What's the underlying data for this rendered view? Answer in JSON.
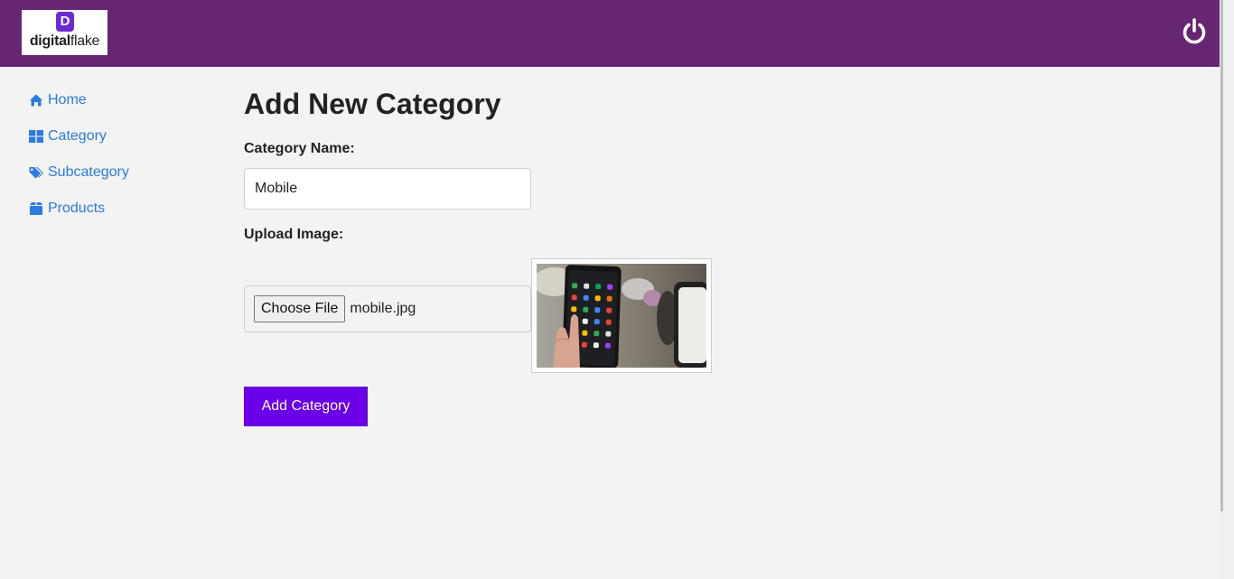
{
  "header": {
    "logo_letter": "D",
    "logo_text_bold": "digital",
    "logo_text_rest": "flake",
    "power_icon": "power-icon",
    "background": "#662672"
  },
  "sidebar": {
    "items": [
      {
        "label": "Home",
        "icon": "home-icon"
      },
      {
        "label": "Category",
        "icon": "grid-icon"
      },
      {
        "label": "Subcategory",
        "icon": "tags-icon"
      },
      {
        "label": "Products",
        "icon": "box-icon"
      }
    ],
    "link_color": "#2b7be0"
  },
  "form": {
    "title": "Add New Category",
    "name_label": "Category Name:",
    "name_value": "Mobile",
    "upload_label": "Upload Image:",
    "choose_file_label": "Choose File",
    "file_name": "mobile.jpg",
    "preview_icon": "phone-photo-preview",
    "submit_label": "Add Category",
    "submit_color": "#6a00e8"
  }
}
